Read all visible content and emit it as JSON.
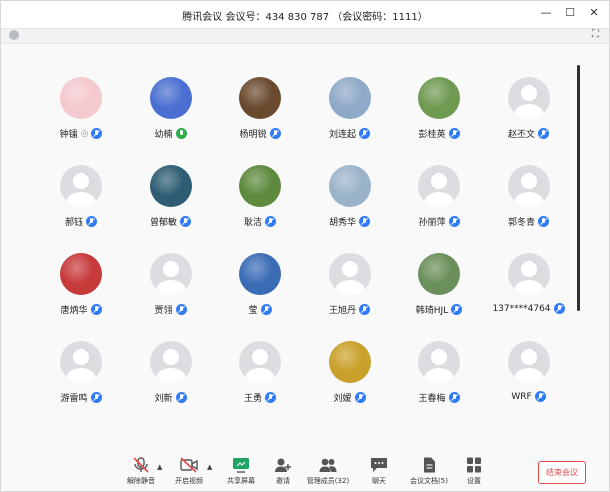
{
  "window": {
    "title": "腾讯会议 会议号：434 830 787 （会议密码：1111）",
    "minimize": "—",
    "maximize": "☐",
    "close": "✕",
    "fullscreen": "⛶"
  },
  "participants": [
    {
      "name": "钟镭",
      "mic": "muted",
      "avatar": "photo",
      "color": "#f4c9cf",
      "suffix": "◎"
    },
    {
      "name": "幼楠",
      "mic": "active",
      "avatar": "photo",
      "color": "#4a6fd0"
    },
    {
      "name": "杨明锐",
      "mic": "muted",
      "avatar": "photo",
      "color": "#6a4a2e"
    },
    {
      "name": "刘连起",
      "mic": "muted",
      "avatar": "photo",
      "color": "#8fa9c8"
    },
    {
      "name": "彭桂英",
      "mic": "muted",
      "avatar": "photo",
      "color": "#6f9a52"
    },
    {
      "name": "赵丕文",
      "mic": "muted",
      "avatar": "placeholder"
    },
    {
      "name": "郝钰",
      "mic": "muted",
      "avatar": "placeholder"
    },
    {
      "name": "曾郁敏",
      "mic": "muted",
      "avatar": "photo",
      "color": "#2e5d73"
    },
    {
      "name": "耿洁",
      "mic": "muted",
      "avatar": "photo",
      "color": "#5d8a3c"
    },
    {
      "name": "胡秀华",
      "mic": "muted",
      "avatar": "photo",
      "color": "#9bb3c9"
    },
    {
      "name": "孙丽萍",
      "mic": "muted",
      "avatar": "placeholder"
    },
    {
      "name": "郭冬青",
      "mic": "muted",
      "avatar": "placeholder"
    },
    {
      "name": "唐炳华",
      "mic": "muted",
      "avatar": "photo",
      "color": "#c73a3a"
    },
    {
      "name": "贾翎",
      "mic": "muted",
      "avatar": "placeholder"
    },
    {
      "name": "莹",
      "mic": "muted",
      "avatar": "photo",
      "color": "#3a6cb5"
    },
    {
      "name": "王旭丹",
      "mic": "muted",
      "avatar": "placeholder"
    },
    {
      "name": "韩琦HJL",
      "mic": "muted",
      "avatar": "photo",
      "color": "#6b8f5a"
    },
    {
      "name": "137****4764",
      "mic": "muted",
      "avatar": "placeholder"
    },
    {
      "name": "游雷鸣",
      "mic": "muted",
      "avatar": "placeholder"
    },
    {
      "name": "刘新",
      "mic": "muted",
      "avatar": "placeholder"
    },
    {
      "name": "王勇",
      "mic": "muted",
      "avatar": "placeholder"
    },
    {
      "name": "刘嫒",
      "mic": "muted",
      "avatar": "photo",
      "color": "#c9a02a"
    },
    {
      "name": "王春梅",
      "mic": "muted",
      "avatar": "placeholder"
    },
    {
      "name": "WRF",
      "mic": "muted",
      "avatar": "placeholder"
    }
  ],
  "toolbar": {
    "unmute": "解除静音",
    "start_video": "开启视频",
    "share_screen": "共享屏幕",
    "invite": "邀请",
    "members": "管理成员(32)",
    "chat": "聊天",
    "docs": "会议文档(5)",
    "settings": "设置",
    "end": "结束会议",
    "caret": "▲"
  },
  "colors": {
    "accent_blue": "#2f7cf6",
    "mic_active_green": "#2fae4a",
    "end_red": "#e04a48",
    "share_green": "#1fa463"
  }
}
